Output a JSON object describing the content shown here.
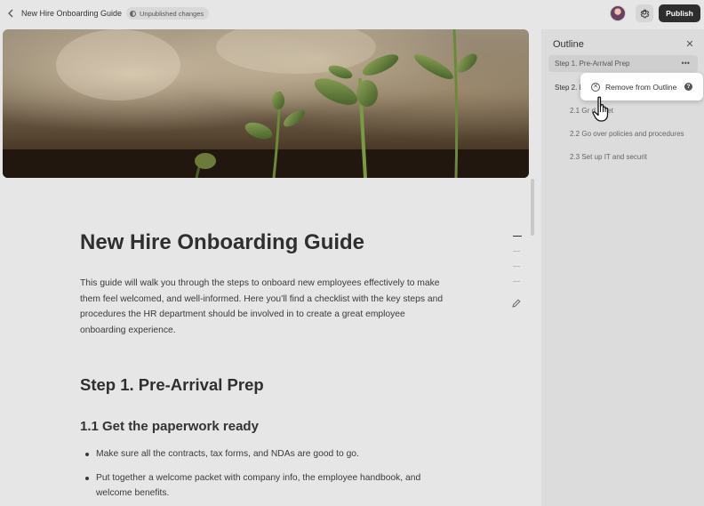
{
  "topbar": {
    "back_icon": "chevron-left-icon",
    "title": "New Hire Onboarding Guide",
    "status": "Unpublished changes",
    "settings_icon": "gear-icon",
    "publish_label": "Publish"
  },
  "document": {
    "title": "New Hire Onboarding Guide",
    "intro": "This guide will walk you through the steps to onboard new employees effectively to make them feel welcomed, and well-informed. Here you’ll find a checklist with the key steps and procedures the HR department should be involved in to create a great employee onboarding experience.",
    "step1_heading": "Step 1. Pre-Arrival Prep",
    "subheading": "1.1 Get the paperwork ready",
    "bullets": [
      "Make sure all the contracts, tax forms, and NDAs are good to go.",
      "Put together a welcome packet with company info, the employee handbook, and welcome benefits."
    ]
  },
  "outline": {
    "title": "Outline",
    "items": [
      {
        "label": "Step 1. Pre-Arrival Prep"
      },
      {
        "label": "Step 2. I"
      },
      {
        "label": "2.1 Gr      d meet"
      },
      {
        "label": "2.2 Go over policies and procedures"
      },
      {
        "label": "2.3 Set up IT and securit"
      }
    ]
  },
  "context_menu": {
    "remove_label": "Remove from Outline",
    "help_glyph": "?"
  },
  "colors": {
    "publish_bg": "#2e2e2e",
    "panel_bg": "#dcdcdc",
    "page_bg": "#e6e6e6"
  }
}
